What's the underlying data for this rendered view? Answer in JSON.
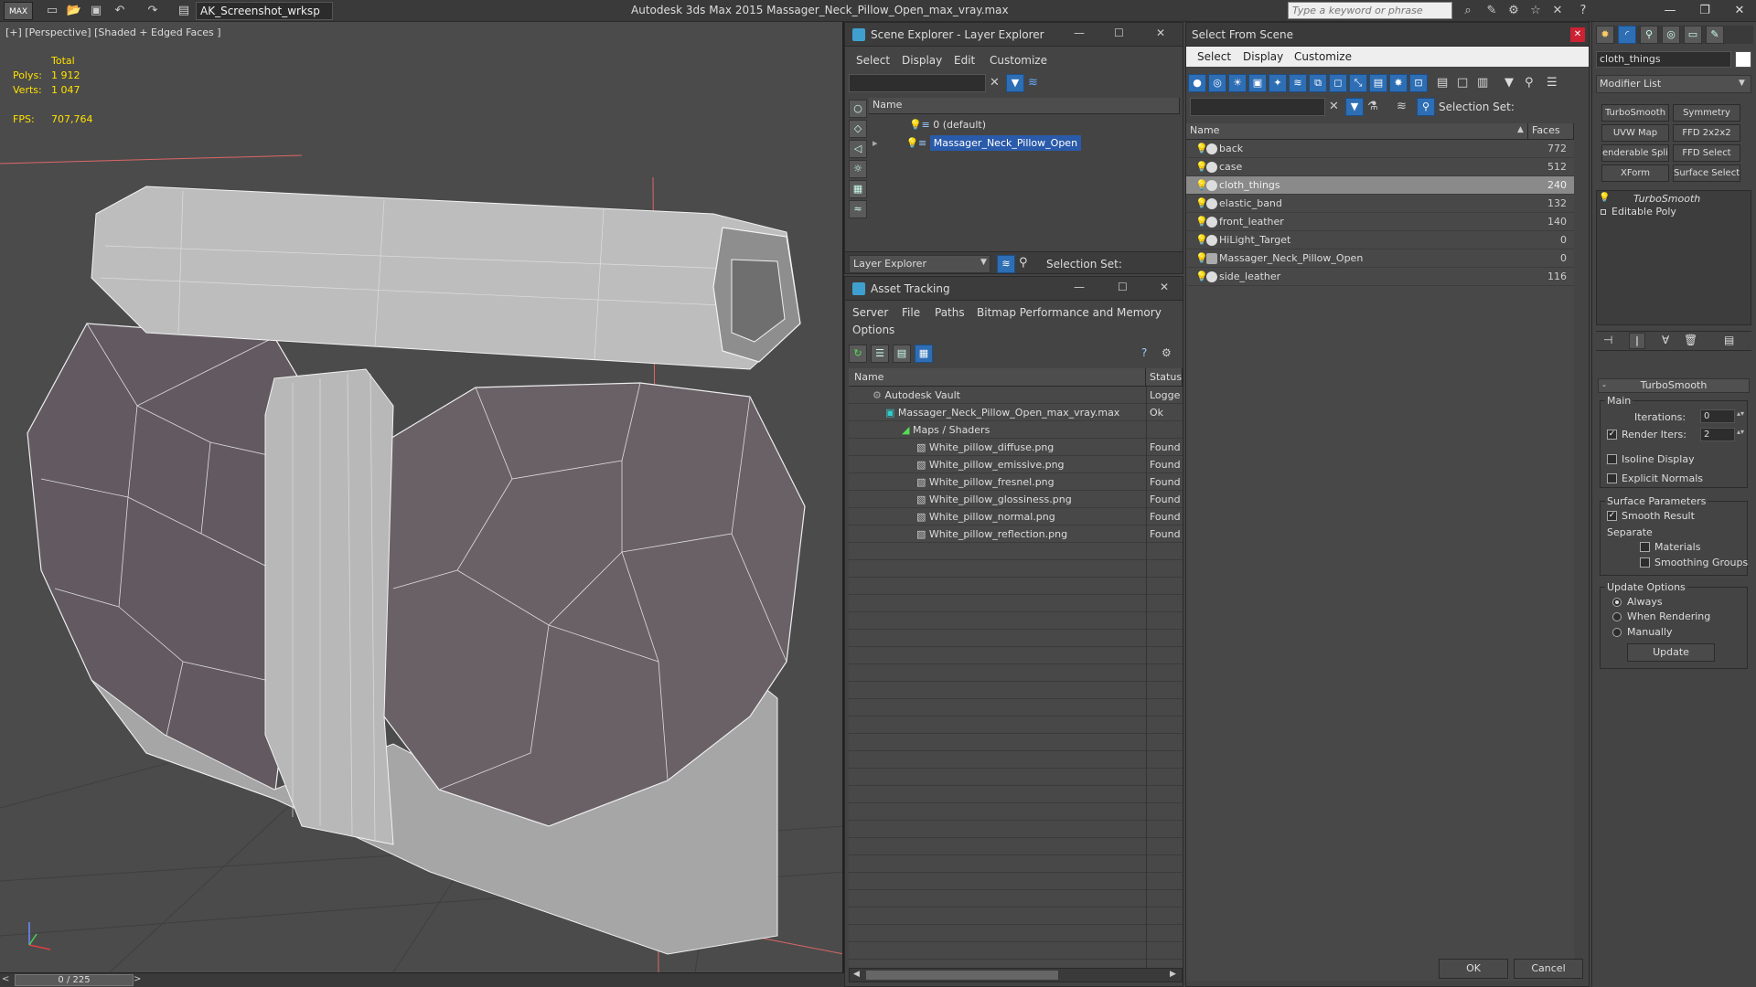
{
  "titlebar": {
    "logo": "MAX",
    "workspace": "AK_Screenshot_wrksp",
    "app_title": "Autodesk 3ds Max  2015     Massager_Neck_Pillow_Open_max_vray.max",
    "search_placeholder": "Type a keyword or phrase"
  },
  "viewport": {
    "label": "[+] [Perspective] [Shaded + Edged Faces ]",
    "stats_header": "Total",
    "polys_label": "Polys:",
    "polys_value": "1 912",
    "verts_label": "Verts:",
    "verts_value": "1 047",
    "fps_label": "FPS:",
    "fps_value": "707,764",
    "frame_counter": "0 / 225"
  },
  "scene_explorer": {
    "title": "Scene Explorer - Layer Explorer",
    "menu": [
      "Select",
      "Display",
      "Edit",
      "Customize"
    ],
    "column_name": "Name",
    "layers": [
      "0 (default)",
      "Massager_Neck_Pillow_Open"
    ],
    "footer_dropdown": "Layer Explorer",
    "selection_set_label": "Selection Set:"
  },
  "asset_tracking": {
    "title": "Asset Tracking",
    "menu": [
      "Server",
      "File",
      "Paths",
      "Bitmap Performance and Memory",
      "Options"
    ],
    "col_name": "Name",
    "col_status": "Status",
    "rows": [
      {
        "name": "Autodesk Vault",
        "status": "Logge"
      },
      {
        "name": "Massager_Neck_Pillow_Open_max_vray.max",
        "status": "Ok"
      },
      {
        "name": "Maps / Shaders",
        "status": ""
      },
      {
        "name": "White_pillow_diffuse.png",
        "status": "Found"
      },
      {
        "name": "White_pillow_emissive.png",
        "status": "Found"
      },
      {
        "name": "White_pillow_fresnel.png",
        "status": "Found"
      },
      {
        "name": "White_pillow_glossiness.png",
        "status": "Found"
      },
      {
        "name": "White_pillow_normal.png",
        "status": "Found"
      },
      {
        "name": "White_pillow_reflection.png",
        "status": "Found"
      }
    ]
  },
  "select_from_scene": {
    "title": "Select From Scene",
    "menu": [
      "Select",
      "Display",
      "Customize"
    ],
    "selection_set_label": "Selection Set:",
    "col_name": "Name",
    "col_faces": "Faces",
    "rows": [
      {
        "name": "back",
        "faces": "772"
      },
      {
        "name": "case",
        "faces": "512"
      },
      {
        "name": "cloth_things",
        "faces": "240"
      },
      {
        "name": "elastic_band",
        "faces": "132"
      },
      {
        "name": "front_leather",
        "faces": "140"
      },
      {
        "name": "HiLight_Target",
        "faces": "0"
      },
      {
        "name": "Massager_Neck_Pillow_Open",
        "faces": "0"
      },
      {
        "name": "side_leather",
        "faces": "116"
      }
    ],
    "ok_label": "OK",
    "cancel_label": "Cancel"
  },
  "command_panel": {
    "object_name": "cloth_things",
    "modifier_list": "Modifier List",
    "modifier_buttons": [
      "TurboSmooth",
      "Symmetry",
      "UVW Map",
      "FFD 2x2x2",
      "enderable Splin",
      "FFD Select",
      "XForm",
      "Surface Select"
    ],
    "stack": [
      "TurboSmooth",
      "Editable Poly"
    ],
    "rollout_title": "TurboSmooth",
    "main_label": "Main",
    "iterations_label": "Iterations:",
    "iterations_value": "0",
    "render_iters_label": "Render Iters:",
    "render_iters_value": "2",
    "isoline_label": "Isoline Display",
    "explicit_normals_label": "Explicit Normals",
    "surface_params_label": "Surface Parameters",
    "smooth_result_label": "Smooth Result",
    "separate_label": "Separate",
    "materials_label": "Materials",
    "smoothing_groups_label": "Smoothing Groups",
    "update_options_label": "Update Options",
    "always_label": "Always",
    "when_rendering_label": "When Rendering",
    "manually_label": "Manually",
    "update_button": "Update"
  }
}
